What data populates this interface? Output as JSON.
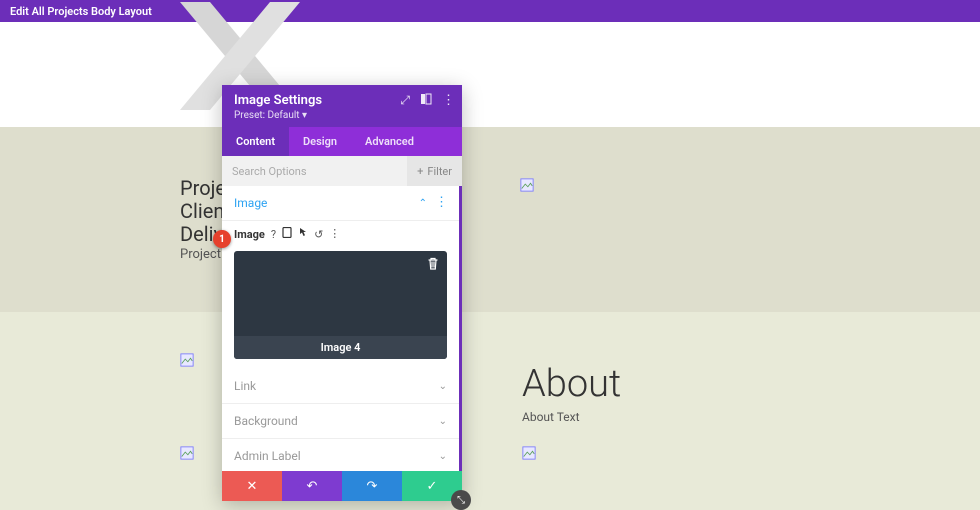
{
  "topbar": {
    "title": "Edit All Projects Body Layout"
  },
  "background": {
    "lines": [
      "Projec",
      "Client",
      "Delive"
    ],
    "sub": "Project I",
    "about_heading": "About",
    "about_sub": "About Text"
  },
  "modal": {
    "title": "Image Settings",
    "preset": "Preset: Default ",
    "preset_caret": "▾",
    "tabs": {
      "content": "Content",
      "design": "Design",
      "advanced": "Advanced"
    },
    "search_placeholder": "Search Options",
    "filter_label": "Filter",
    "sections": {
      "image": "Image",
      "link": "Link",
      "background": "Background",
      "admin": "Admin Label"
    },
    "field_label": "Image",
    "image_caption": "Image 4",
    "badge": "1"
  }
}
